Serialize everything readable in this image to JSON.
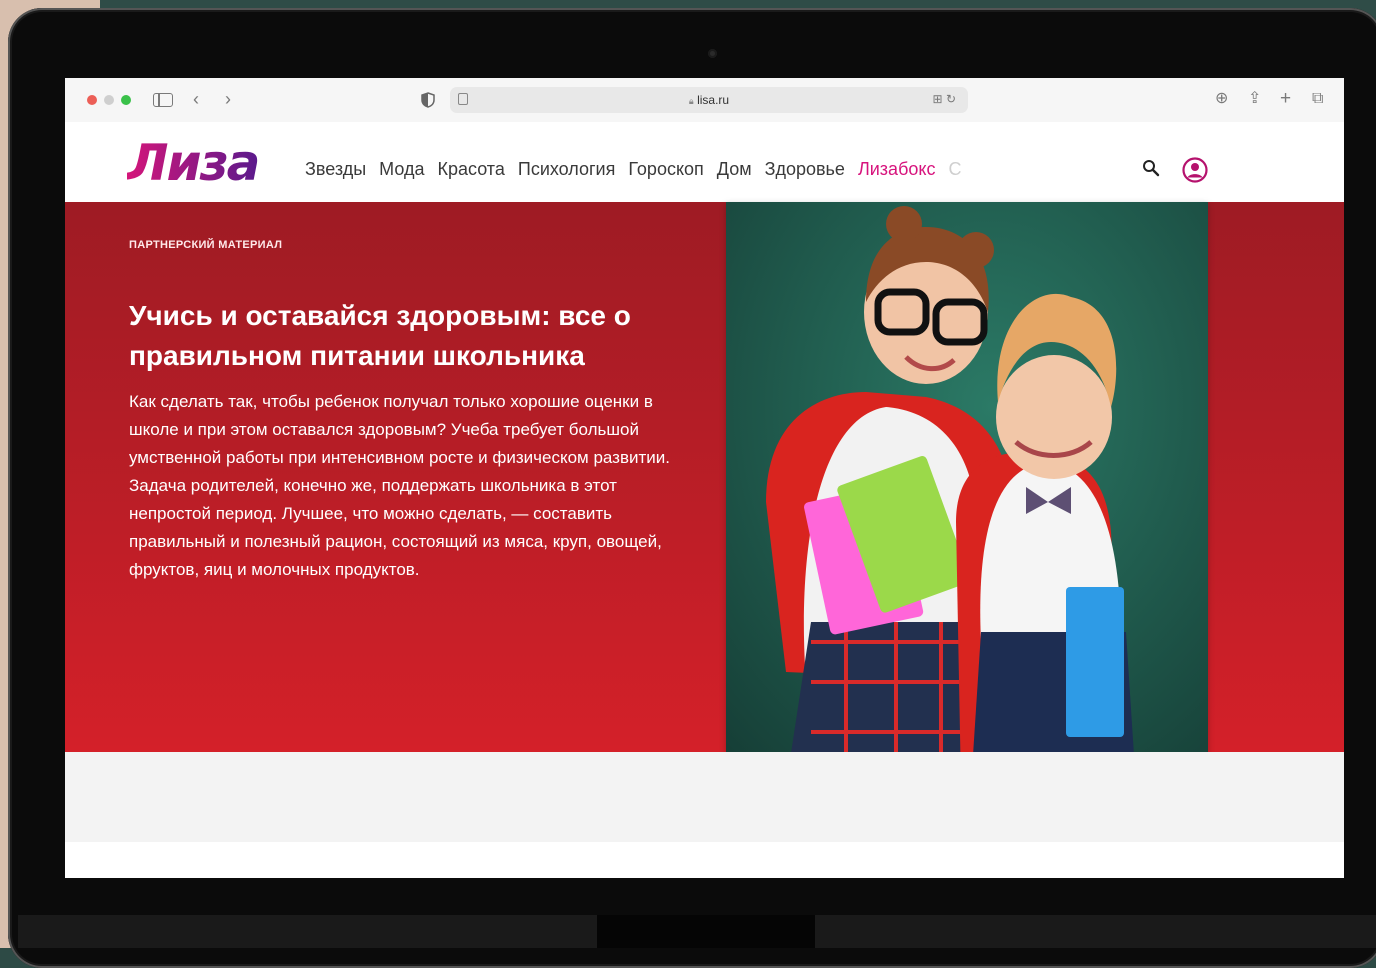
{
  "browser": {
    "url": "lisa.ru"
  },
  "site": {
    "logo": "Лиза",
    "nav": [
      {
        "label": "Звезды"
      },
      {
        "label": "Мода"
      },
      {
        "label": "Красота"
      },
      {
        "label": "Психология"
      },
      {
        "label": "Гороскоп"
      },
      {
        "label": "Дом"
      },
      {
        "label": "Здоровье"
      },
      {
        "label": "Лизабокс"
      },
      {
        "label": "С"
      }
    ]
  },
  "article": {
    "label": "ПАРТНЕРСКИЙ МАТЕРИАЛ",
    "title": "Учись и оставайся здоровым: все о правильном питании школьника",
    "lede": "Как сделать так, чтобы ребенок получал только хорошие оценки в школе и при этом оставался здоровым? Учеба требует большой умственной работы при интенсивном росте и физическом развитии. Задача родителей, конечно же, поддержать школьника в этот непростой период. Лучшее, что можно сделать, — составить правильный и полезный рацион, состоящий из мяса, круп, овощей, фруктов, яиц и молочных продуктов."
  },
  "colors": {
    "accent": "#d7147d",
    "hero_top": "#9e1b24",
    "hero_bottom": "#d42029",
    "photo_bg": "#1f5a4b"
  },
  "icons": [
    "sidebar-icon",
    "back-icon",
    "forward-icon",
    "privacy-shield-icon",
    "reader-icon",
    "lock-icon",
    "translate-icon",
    "reload-icon",
    "download-icon",
    "share-icon",
    "new-tab-icon",
    "tabs-overview-icon",
    "search-icon",
    "user-icon"
  ]
}
